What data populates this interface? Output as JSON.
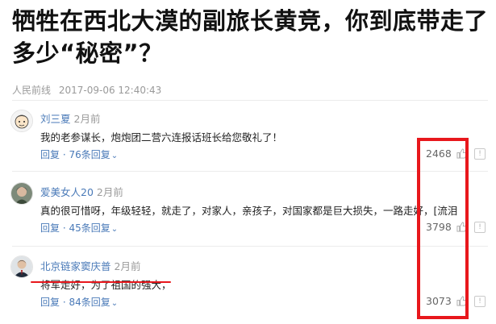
{
  "article": {
    "title": "牺牲在西北大漠的副旅长黄竞，你到底带走了多少“秘密”？",
    "source": "人民前线",
    "datetime": "2017-09-06 12:40:43"
  },
  "comments": [
    {
      "user": "刘三夏",
      "time": "2月前",
      "text": "我的老参谋长，炮炮团二营六连报话班长给您敬礼了！",
      "reply": "回复 · 76条回复",
      "likes": "2468",
      "avatar_icon": "cartoon-avatar"
    },
    {
      "user": "爱美女人20",
      "time": "2月前",
      "text": "真的很可惜呀，年级轻轻，就走了，对家人，亲孩子，对国家都是巨大损失，一路走好，[流泪",
      "reply": "回复 · 45条回复",
      "likes": "3798",
      "avatar_icon": "photo-avatar"
    },
    {
      "user": "北京链家窦庆普",
      "time": "2月前",
      "text": "将军走好，为了祖国的强大，",
      "reply": "回复 · 84条回复",
      "likes": "3073",
      "avatar_icon": "portrait-avatar"
    }
  ],
  "icons": {
    "like": "thumbs-up-icon",
    "report": "report-icon",
    "expand": "chevron-down-icon"
  },
  "report_glyph": "!",
  "colors": {
    "link": "#4a7ab8",
    "annotation": "#e8171c",
    "muted": "#9a9a9a"
  }
}
